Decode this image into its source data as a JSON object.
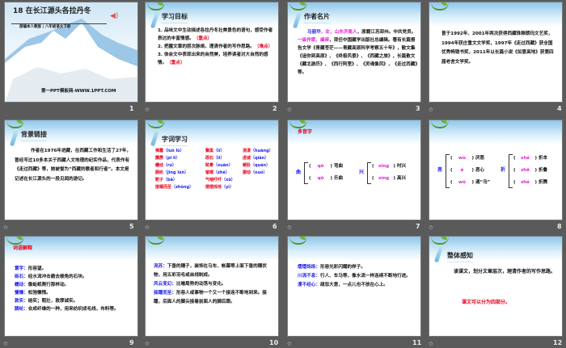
{
  "slides": [
    {
      "number": "1",
      "title": "18  在长江源头各拉丹冬",
      "subtitle": "部编本人教版 | 八年级语文下册",
      "footer": "第一PPT模板网-WWW.1PPT.COM"
    },
    {
      "number": "2",
      "title": "学习目标",
      "items": [
        {
          "text": "1. 品味文中生动描述各拉丹冬壮美景色的语句，感受作者表达的丰富情感。",
          "tag": "（重点）"
        },
        {
          "text": "2. 把握文章的层次脉络，理清作者的写作思路。",
          "tag": "（难点）"
        },
        {
          "text": "3. 体会文中表现出来的自然美，培养读者对大自然的感情。",
          "tag": "（重点）"
        }
      ]
    },
    {
      "number": "3",
      "title": "作者名片",
      "name": "马丽华",
      "sex": "，女，",
      "origin": "山东济南人",
      "p1": "，原籍江苏邳州。中共党员。",
      "rank": "一级作家、编审",
      "p2": "，现任中国藏学出版社总编辑。著有长篇报告文学《青藏苍茫——青藏高原科学考察五十年》，散文集《追你到高原》、《终极风景》、《西藏之旅》，长篇散文《藏北游历》、《西行阿里》、《灵魂像风》，《走过西藏》等。"
    },
    {
      "number": "4",
      "body": "曾于1992年、2001年两次获得西藏珠穆朗玛文艺奖，1994年获庄重文文学奖，1997年《走过西藏》获全国优秀畅销书奖，2011年以长篇小说《如意高地》获第四届老舍文学奖。"
    },
    {
      "number": "5",
      "title": "背景链接",
      "body": "作者在1976年进藏，在西藏工作和生活了27年，曾经写过10多本关于西藏人文地理的纪实作品，代表作有《走过西藏》等，她被誉为“西藏的歌者和行者”。本文是记述在长江源头的一段见闻的游记。"
    },
    {
      "number": "6",
      "title": "字词学习",
      "words": [
        {
          "w": "裸露",
          "p": "（luǒ lù）"
        },
        {
          "w": "黧黑",
          "p": "（lí）"
        },
        {
          "w": "滉漾",
          "p": "（huàng）"
        },
        {
          "w": "霹雳",
          "p": "（pī lì）"
        },
        {
          "w": "砾石",
          "p": "（lì）"
        },
        {
          "w": "虔诚",
          "p": "（qián）"
        },
        {
          "w": "蠕动",
          "p": "（rú）"
        },
        {
          "w": "眩晕",
          "p": "（xuàn）"
        },
        {
          "w": "蜷卧",
          "p": "（quán）"
        },
        {
          "w": "腈纶",
          "p": "（jīng lún）"
        },
        {
          "w": "皱褶",
          "p": "（zhě）"
        },
        {
          "w": "挪动",
          "p": "（nuó）"
        },
        {
          "w": "靶子",
          "p": "（bǎ）"
        },
        {
          "w": "气喘吁吁",
          "p": "（xū）"
        },
        {
          "w": "",
          "p": ""
        },
        {
          "w": "接踵而至",
          "p": "（zhǒng）"
        },
        {
          "w": "熠熠烁烁",
          "p": "（yì）"
        },
        {
          "w": "",
          "p": ""
        }
      ]
    },
    {
      "number": "7",
      "title": "多音字",
      "groups": [
        {
          "char": "曲",
          "items": [
            {
              "p": "qū",
              "w": "弯曲"
            },
            {
              "p": "qǔ",
              "w": "乐曲"
            }
          ]
        },
        {
          "char": "兴",
          "items": [
            {
              "p": "xīng",
              "w": "时兴"
            },
            {
              "p": "xìng",
              "w": "高兴"
            }
          ]
        }
      ]
    },
    {
      "number": "8",
      "groups": [
        {
          "char": "恶",
          "items": [
            {
              "p": "wù",
              "w": "厌恶"
            },
            {
              "p": "ě",
              "w": "恶心"
            },
            {
              "p": "wū",
              "w": "通“乌”"
            }
          ]
        },
        {
          "char": "折",
          "items": [
            {
              "p": "shé",
              "w": "折本"
            },
            {
              "p": "zhē",
              "w": "折叠"
            },
            {
              "p": "zhé",
              "w": "折腾"
            }
          ]
        }
      ]
    },
    {
      "number": "9",
      "title": "词语解释",
      "defs": [
        {
          "t": "寰宇：",
          "d": "形容望。"
        },
        {
          "t": "砾石：",
          "d": "经水流冲击磨去棱角的石块。"
        },
        {
          "t": "蠕动：",
          "d": "像蚯蚓爬行那样动。"
        },
        {
          "t": "慵懒：",
          "d": "松弛懒惰。"
        },
        {
          "t": "敦实：",
          "d": "结实；粗壮，敦厚诚实。"
        },
        {
          "t": "腈纶：",
          "d": "合成纤维的一种，用来纺织成毛线，布料等。"
        }
      ]
    },
    {
      "number": "10",
      "defs": [
        {
          "t": "流苏：",
          "d": "下垂的穗子，装饰在马车、帐幕等上面下垂的穗状物，用五彩羽毛或丝线制成。"
        },
        {
          "t": "风云变幻：",
          "d": "比喻局势的动荡与变化。"
        },
        {
          "t": "接踵而至：",
          "d": "形容人或事物一个又一个接连不断地到来。接踵，后面人的脚尖接着前面人的脚后跟。"
        }
      ]
    },
    {
      "number": "11",
      "defs": [
        {
          "t": "熠熠烁烁：",
          "d": "形容光彩闪耀的样子。"
        },
        {
          "t": "川流不息：",
          "d": "行人、车马等，像水流一样连续不断地行进。"
        },
        {
          "t": "漫不经心：",
          "d": "疏忽大意，一点儿也不放在心上。"
        }
      ]
    },
    {
      "number": "12",
      "title": "整体感知",
      "body": "读课文，划分文章层次，理清作者的写作思路。",
      "note": "课文可以分为四部分。"
    }
  ],
  "colors": {
    "accent_red": "#e8001c",
    "accent_blue": "#1a1aee",
    "pinyin": "#e020d0",
    "background": "#5a5a5a"
  }
}
